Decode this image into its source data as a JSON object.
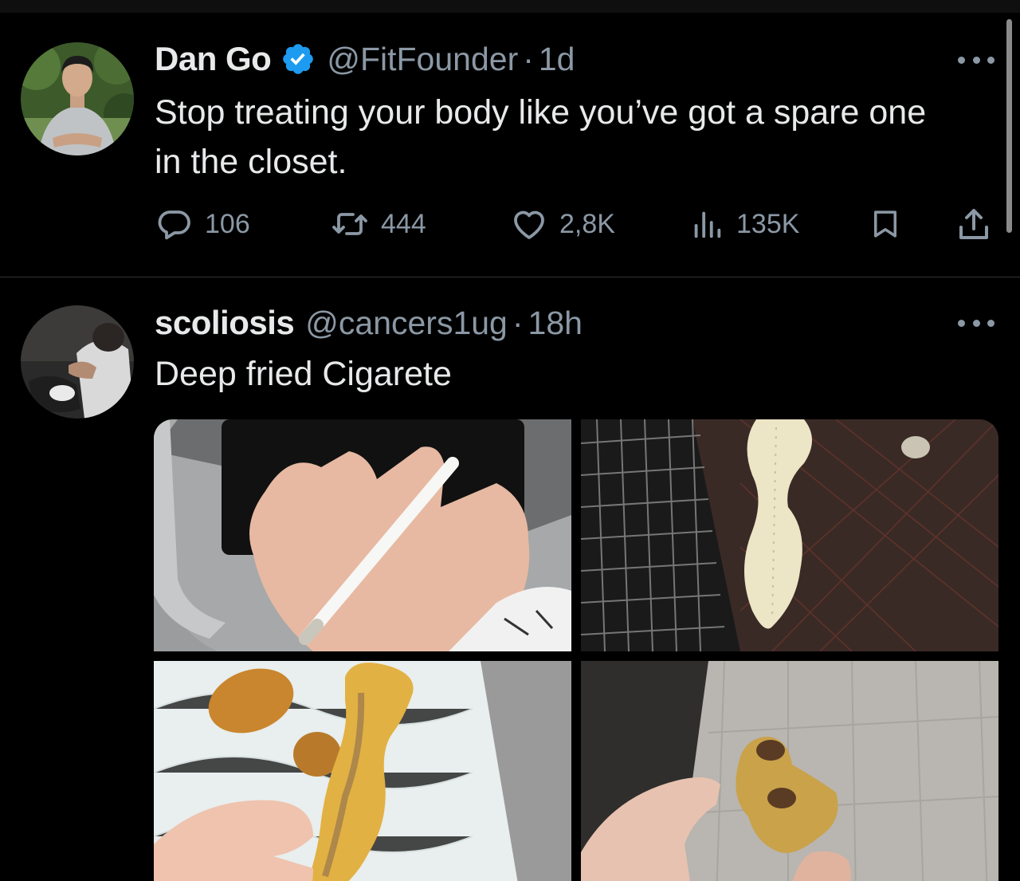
{
  "tweets": [
    {
      "display_name": "Dan Go",
      "verified": true,
      "handle": "@FitFounder",
      "separator": "·",
      "time": "1d",
      "text": "Stop treating your body like you’ve got a spare one in the closet.",
      "stats": {
        "replies": "106",
        "retweets": "444",
        "likes": "2,8K",
        "views": "135K"
      }
    },
    {
      "display_name": "scoliosis",
      "verified": false,
      "handle": "@cancers1ug",
      "separator": "·",
      "time": "18h",
      "text": "Deep fried Cigarete"
    }
  ],
  "colors": {
    "background": "#000000",
    "text_primary": "#e7e9ea",
    "text_secondary": "#8b98a5",
    "verified_blue": "#1d9bf0",
    "divider": "#2f3336"
  },
  "icons": [
    "reply-icon",
    "retweet-icon",
    "like-icon",
    "views-icon",
    "bookmark-icon",
    "share-icon",
    "more-icon",
    "verified-badge-icon"
  ]
}
